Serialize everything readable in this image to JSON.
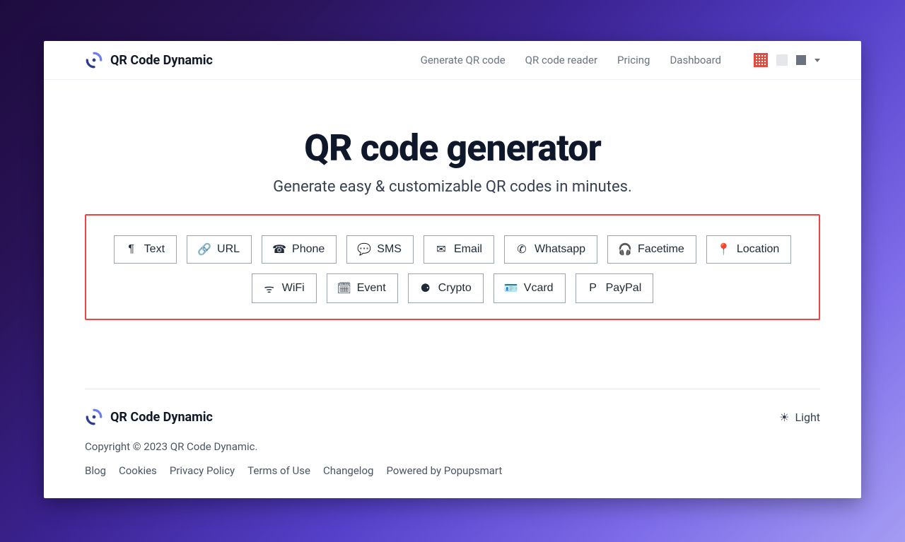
{
  "brand": {
    "name": "QR Code Dynamic"
  },
  "nav": {
    "items": [
      {
        "label": "Generate QR code"
      },
      {
        "label": "QR code reader"
      },
      {
        "label": "Pricing"
      },
      {
        "label": "Dashboard"
      }
    ]
  },
  "hero": {
    "title": "QR code generator",
    "subtitle": "Generate easy & customizable QR codes in minutes."
  },
  "types": [
    {
      "key": "text",
      "label": "Text",
      "icon": "pilcrow-icon"
    },
    {
      "key": "url",
      "label": "URL",
      "icon": "link-icon"
    },
    {
      "key": "phone",
      "label": "Phone",
      "icon": "phone-icon"
    },
    {
      "key": "sms",
      "label": "SMS",
      "icon": "chat-icon"
    },
    {
      "key": "email",
      "label": "Email",
      "icon": "envelope-icon"
    },
    {
      "key": "whatsapp",
      "label": "Whatsapp",
      "icon": "whatsapp-icon"
    },
    {
      "key": "facetime",
      "label": "Facetime",
      "icon": "headset-icon"
    },
    {
      "key": "location",
      "label": "Location",
      "icon": "pin-icon"
    },
    {
      "key": "wifi",
      "label": "WiFi",
      "icon": "wifi-icon"
    },
    {
      "key": "event",
      "label": "Event",
      "icon": "calendar-icon"
    },
    {
      "key": "crypto",
      "label": "Crypto",
      "icon": "coin-icon"
    },
    {
      "key": "vcard",
      "label": "Vcard",
      "icon": "id-card-icon"
    },
    {
      "key": "paypal",
      "label": "PayPal",
      "icon": "paypal-icon"
    }
  ],
  "footer": {
    "brand": "QR Code Dynamic",
    "theme_label": "Light",
    "copyright": "Copyright © 2023 QR Code Dynamic.",
    "links": [
      {
        "label": "Blog"
      },
      {
        "label": "Cookies"
      },
      {
        "label": "Privacy Policy"
      },
      {
        "label": "Terms of Use"
      },
      {
        "label": "Changelog"
      },
      {
        "label": "Powered by Popupsmart"
      }
    ]
  },
  "icons": {
    "pilcrow-icon": "¶",
    "link-icon": "🔗",
    "phone-icon": "☎",
    "chat-icon": "💬",
    "envelope-icon": "✉",
    "whatsapp-icon": "✆",
    "headset-icon": "🎧",
    "pin-icon": "📍",
    "wifi-icon": "ᯤ",
    "calendar-icon": "🗓",
    "coin-icon": "⚈",
    "id-card-icon": "🪪",
    "paypal-icon": "P",
    "sun-icon": "☀"
  }
}
